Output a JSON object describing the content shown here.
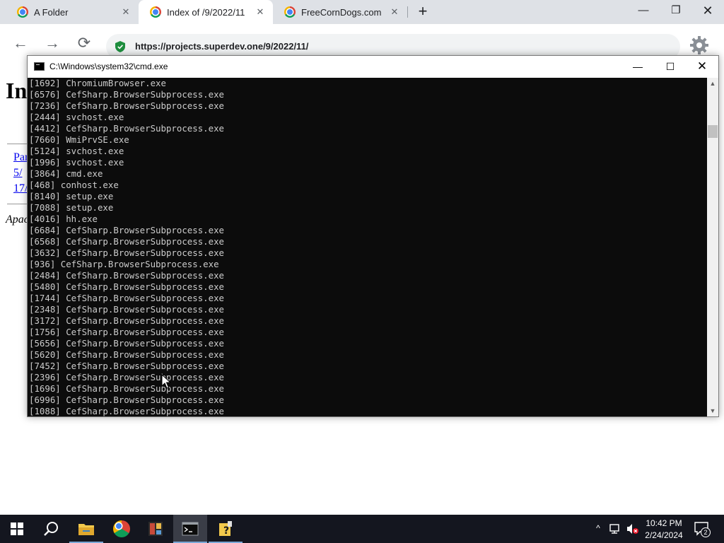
{
  "browser": {
    "tabs": [
      {
        "title": "A Folder"
      },
      {
        "title": "Index of /9/2022/11"
      },
      {
        "title": "FreeCornDogs.com"
      }
    ],
    "close_glyph": "✕",
    "new_tab_glyph": "+",
    "window_controls": {
      "minimize": "—",
      "maximize": "❐",
      "close": "✕"
    },
    "nav": {
      "back": "←",
      "forward": "→",
      "reload": "⟳"
    },
    "address_bar": {
      "url": "https://projects.superdev.one/9/2022/11/"
    },
    "icons": {
      "security": "shield-icon",
      "settings": "gear-icon"
    }
  },
  "page": {
    "heading": "In",
    "links": [
      "Par",
      "5/",
      "17/"
    ],
    "address": "Apac"
  },
  "cmd_window": {
    "title": "C:\\Windows\\system32\\cmd.exe",
    "controls": {
      "minimize": "—",
      "maximize": "☐",
      "close": "✕"
    },
    "scroll": {
      "up": "▲",
      "down": "▼"
    },
    "lines": [
      "[1692] ChromiumBrowser.exe",
      "[6576] CefSharp.BrowserSubprocess.exe",
      "[7236] CefSharp.BrowserSubprocess.exe",
      "[2444] svchost.exe",
      "[4412] CefSharp.BrowserSubprocess.exe",
      "[7660] WmiPrvSE.exe",
      "[5124] svchost.exe",
      "[1996] svchost.exe",
      "[3864] cmd.exe",
      "[468] conhost.exe",
      "[8140] setup.exe",
      "[7088] setup.exe",
      "[4016] hh.exe",
      "[6684] CefSharp.BrowserSubprocess.exe",
      "[6568] CefSharp.BrowserSubprocess.exe",
      "[3632] CefSharp.BrowserSubprocess.exe",
      "[936] CefSharp.BrowserSubprocess.exe",
      "[2484] CefSharp.BrowserSubprocess.exe",
      "[5480] CefSharp.BrowserSubprocess.exe",
      "[1744] CefSharp.BrowserSubprocess.exe",
      "[2348] CefSharp.BrowserSubprocess.exe",
      "[3172] CefSharp.BrowserSubprocess.exe",
      "[1756] CefSharp.BrowserSubprocess.exe",
      "[5656] CefSharp.BrowserSubprocess.exe",
      "[5620] CefSharp.BrowserSubprocess.exe",
      "[7452] CefSharp.BrowserSubprocess.exe",
      "[2396] CefSharp.BrowserSubprocess.exe",
      "[1696] CefSharp.BrowserSubprocess.exe",
      "[6996] CefSharp.BrowserSubprocess.exe",
      "[1088] CefSharp.BrowserSubprocess.exe"
    ]
  },
  "taskbar": {
    "apps": [
      "start-icon",
      "search-icon",
      "file-explorer-icon",
      "chrome-icon",
      "app-icon",
      "cmd-icon",
      "help-icon"
    ],
    "tray_chevron": "^",
    "clock": {
      "time": "10:42 PM",
      "date": "2/24/2024"
    },
    "notifications_count": "2"
  },
  "colors": {
    "console_bg": "#0c0c0c",
    "console_text": "#cccccc",
    "taskbar_bg": "#14161f",
    "link": "#0000ee"
  }
}
